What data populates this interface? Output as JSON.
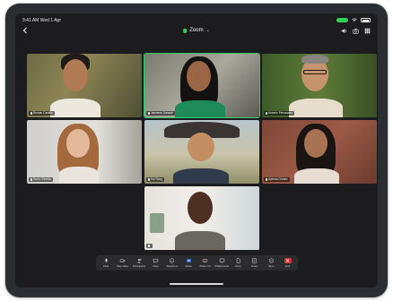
{
  "status": {
    "time": "9:41 AM",
    "date": "Wed 1 Apr"
  },
  "header": {
    "title": "Zoom"
  },
  "participants": [
    {
      "name": "Roman Castillo"
    },
    {
      "name": "Jasmeen Dansah"
    },
    {
      "name": "Antonio Fernandez"
    },
    {
      "name": "Daria Oleshko"
    },
    {
      "name": "Kai Song"
    },
    {
      "name": "Ayesha Gomez"
    },
    {
      "name": ""
    }
  ],
  "toolbar": {
    "items": [
      {
        "label": "Mute",
        "icon": "microphone-icon"
      },
      {
        "label": "Stop video",
        "icon": "video-camera-icon"
      },
      {
        "label": "Participants",
        "icon": "participants-icon"
      },
      {
        "label": "Chat",
        "icon": "chat-icon"
      },
      {
        "label": "Reactions",
        "icon": "reaction-icon"
      },
      {
        "label": "Share",
        "icon": "share-icon"
      },
      {
        "label": "Share CC",
        "icon": "captions-icon"
      },
      {
        "label": "Whiteboards",
        "icon": "whiteboard-icon"
      },
      {
        "label": "Docs",
        "icon": "docs-icon"
      },
      {
        "label": "Notes",
        "icon": "notes-icon"
      },
      {
        "label": "More",
        "icon": "more-icon"
      },
      {
        "label": "End",
        "icon": "end-icon"
      }
    ]
  },
  "colors": {
    "active_speaker": "#2ecc71",
    "end": "#e03131",
    "status_pill": "#30d158"
  }
}
